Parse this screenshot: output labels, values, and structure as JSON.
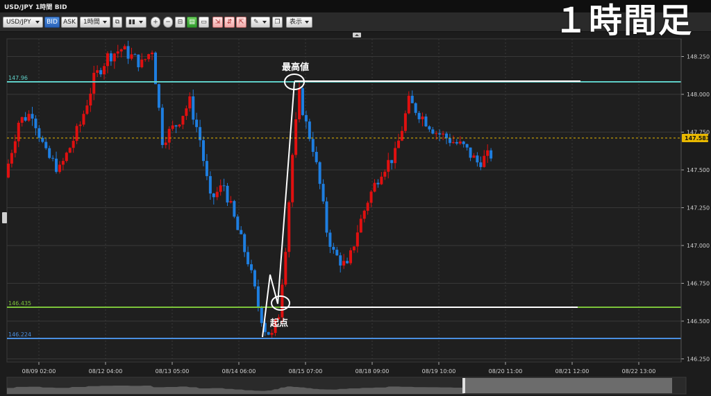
{
  "window": {
    "title": "USD/JPY 1時間 BID"
  },
  "overlay_title": "１時間足",
  "toolbar": {
    "symbol": "USD/JPY",
    "bid_label": "BID",
    "ask_label": "ASK",
    "timeframe": "1時間",
    "display_label": "表示"
  },
  "colors": {
    "background": "#1c1c1c",
    "grid": "#383838",
    "bullish": "#e01010",
    "bearish": "#1e7ee0",
    "line_147": "#5fd0c8",
    "line_146_435": "#7cc43a",
    "line_146_224": "#4a8fe0",
    "price_tag": "#e8b800",
    "annotation": "#ffffff"
  },
  "chart_data": {
    "type": "candlestick",
    "x_ticks": [
      "08/09 02:00",
      "08/12 04:00",
      "08/13 05:00",
      "08/14 06:00",
      "08/15 07:00",
      "08/18 09:00",
      "08/19 10:00",
      "08/20 11:00",
      "08/21 12:00",
      "08/22 13:00"
    ],
    "y_ticks": [
      "148.250",
      "148.000",
      "147.750",
      "147.500",
      "147.250",
      "147.000",
      "146.750",
      "146.500",
      "146.250"
    ],
    "ylim": [
      146.15,
      148.28
    ],
    "current_price": "147.583",
    "horizontal_lines": [
      {
        "label": "147.96",
        "color_key": "line_147"
      },
      {
        "label": "146.435",
        "color_key": "line_146_435"
      },
      {
        "label": "146.224",
        "color_key": "line_146_224"
      }
    ],
    "annotations": {
      "high": "最高値",
      "start": "起点"
    },
    "approx_path": [
      [
        0,
        147.45
      ],
      [
        4,
        147.82
      ],
      [
        8,
        147.88
      ],
      [
        12,
        147.6
      ],
      [
        16,
        147.5
      ],
      [
        22,
        147.8
      ],
      [
        26,
        148.1
      ],
      [
        30,
        148.25
      ],
      [
        34,
        148.3
      ],
      [
        40,
        148.2
      ],
      [
        43,
        148.3
      ],
      [
        46,
        147.7
      ],
      [
        50,
        147.8
      ],
      [
        54,
        147.95
      ],
      [
        57,
        147.7
      ],
      [
        60,
        147.3
      ],
      [
        64,
        147.4
      ],
      [
        68,
        147.1
      ],
      [
        71,
        146.9
      ],
      [
        74,
        146.6
      ],
      [
        76,
        146.45
      ],
      [
        78,
        146.4
      ],
      [
        80,
        146.55
      ],
      [
        82,
        147.0
      ],
      [
        84,
        147.6
      ],
      [
        86,
        148.0
      ],
      [
        88,
        147.8
      ],
      [
        90,
        147.65
      ],
      [
        92,
        147.4
      ],
      [
        94,
        147.1
      ],
      [
        96,
        146.95
      ],
      [
        98,
        146.9
      ],
      [
        100,
        146.85
      ],
      [
        103,
        147.1
      ],
      [
        106,
        147.3
      ],
      [
        110,
        147.5
      ],
      [
        114,
        147.6
      ],
      [
        118,
        147.95
      ],
      [
        122,
        147.85
      ],
      [
        126,
        147.75
      ],
      [
        130,
        147.7
      ],
      [
        134,
        147.65
      ],
      [
        138,
        147.55
      ],
      [
        142,
        147.6
      ]
    ]
  }
}
